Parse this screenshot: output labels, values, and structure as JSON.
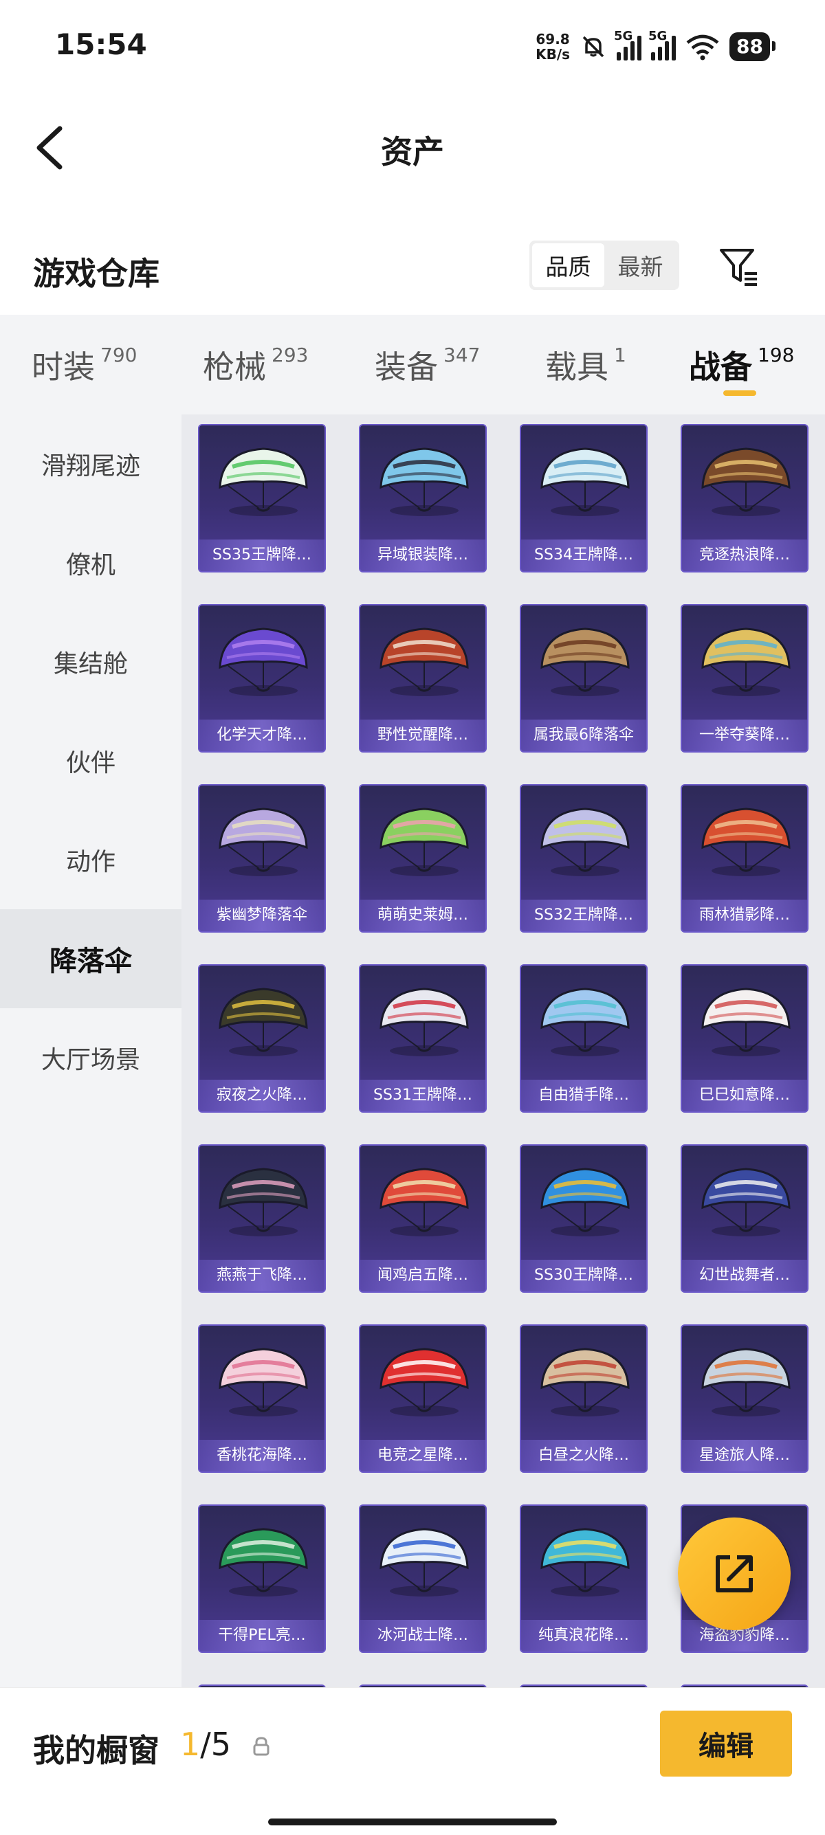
{
  "status_bar": {
    "time": "15:54",
    "net_speed_value": "69.8",
    "net_speed_unit": "KB/s",
    "sig1_label": "5G",
    "sig2_label": "5G",
    "battery": "88"
  },
  "header": {
    "title": "资产"
  },
  "section": {
    "title": "游戏仓库",
    "sort_options": [
      "品质",
      "最新"
    ],
    "active_sort": "品质"
  },
  "tabs": [
    {
      "label": "时装",
      "count": "790"
    },
    {
      "label": "枪械",
      "count": "293"
    },
    {
      "label": "装备",
      "count": "347"
    },
    {
      "label": "载具",
      "count": "1"
    },
    {
      "label": "战备",
      "count": "198"
    }
  ],
  "active_tab": "战备",
  "sidebar": {
    "items": [
      "滑翔尾迹",
      "僚机",
      "集结舱",
      "伙伴",
      "动作",
      "降落伞",
      "大厅场景"
    ],
    "active": "降落伞"
  },
  "items": [
    {
      "name": "SS35王牌降…",
      "color": "#e9f5ea",
      "accent": "#4cc35a"
    },
    {
      "name": "异域银装降…",
      "color": "#7fc7ea",
      "accent": "#2a2a3a"
    },
    {
      "name": "SS34王牌降…",
      "color": "#d9eef5",
      "accent": "#5aa0c8"
    },
    {
      "name": "竞逐热浪降…",
      "color": "#7a4a2a",
      "accent": "#e8c070"
    },
    {
      "name": "化学天才降…",
      "color": "#6a4ad0",
      "accent": "#b080f0"
    },
    {
      "name": "野性觉醒降…",
      "color": "#b8442a",
      "accent": "#f0e0d0"
    },
    {
      "name": "属我最6降落伞",
      "color": "#b89060",
      "accent": "#6a3a20"
    },
    {
      "name": "一举夺葵降…",
      "color": "#e0c060",
      "accent": "#5ab0d0"
    },
    {
      "name": "紫幽梦降落伞",
      "color": "#b8a8e0",
      "accent": "#e8e0c0"
    },
    {
      "name": "萌萌史莱姆…",
      "color": "#8ad060",
      "accent": "#f0a0b0"
    },
    {
      "name": "SS32王牌降…",
      "color": "#c0c0e8",
      "accent": "#d0e060"
    },
    {
      "name": "雨林猎影降…",
      "color": "#d85030",
      "accent": "#f0c090"
    },
    {
      "name": "寂夜之火降…",
      "color": "#3a3a2a",
      "accent": "#e0c040"
    },
    {
      "name": "SS31王牌降…",
      "color": "#e8e8f0",
      "accent": "#d03040"
    },
    {
      "name": "自由猎手降…",
      "color": "#a0c8f0",
      "accent": "#50c0d0"
    },
    {
      "name": "巳巳如意降…",
      "color": "#f4f0f0",
      "accent": "#d05050"
    },
    {
      "name": "燕燕于飞降…",
      "color": "#2a3040",
      "accent": "#e0a0c0"
    },
    {
      "name": "闻鸡启五降…",
      "color": "#e04a3a",
      "accent": "#f0e0b0"
    },
    {
      "name": "SS30王牌降…",
      "color": "#3090e0",
      "accent": "#f0c030"
    },
    {
      "name": "幻世战舞者…",
      "color": "#3a4aa0",
      "accent": "#f0f0f0"
    },
    {
      "name": "香桃花海降…",
      "color": "#f4d0dc",
      "accent": "#e07090"
    },
    {
      "name": "电竞之星降…",
      "color": "#e03030",
      "accent": "#ffffff"
    },
    {
      "name": "白昼之火降…",
      "color": "#d8c0a0",
      "accent": "#c04030"
    },
    {
      "name": "星途旅人降…",
      "color": "#c8d4e0",
      "accent": "#e07030"
    },
    {
      "name": "干得PEL亮…",
      "color": "#2a9a5a",
      "accent": "#e0f0e0"
    },
    {
      "name": "冰河战士降…",
      "color": "#e8f0f8",
      "accent": "#3060d0"
    },
    {
      "name": "纯真浪花降…",
      "color": "#40b8d8",
      "accent": "#f0e060"
    },
    {
      "name": "海盗豹豹降…",
      "color": "#e0a040",
      "accent": "#3a3a3a"
    }
  ],
  "bottom": {
    "label": "我的橱窗",
    "current": "1",
    "separator": "/",
    "total": "5",
    "edit_label": "编辑"
  },
  "colors": {
    "accent": "#f5b82e",
    "card_bg": "#3a2f72",
    "card_border": "#6a58c8"
  }
}
